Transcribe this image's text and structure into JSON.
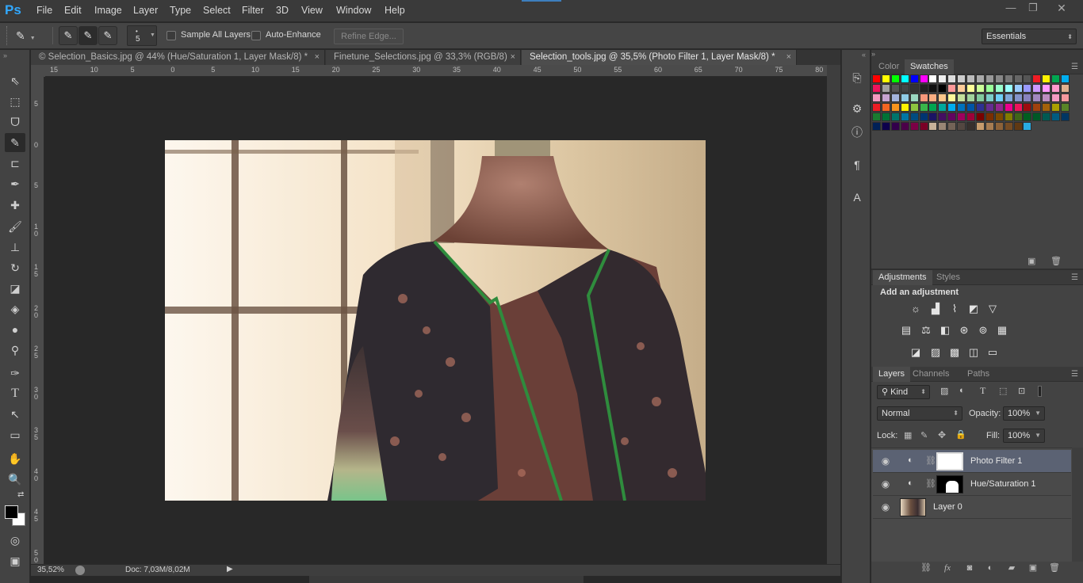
{
  "app": {
    "logo": "Ps"
  },
  "menu": [
    "File",
    "Edit",
    "Image",
    "Layer",
    "Type",
    "Select",
    "Filter",
    "3D",
    "View",
    "Window",
    "Help"
  ],
  "window_controls": {
    "minimize": "—",
    "restore": "❐",
    "close": "✕"
  },
  "options": {
    "brush_size": "5",
    "sample_all_layers": "Sample All Layers",
    "auto_enhance": "Auto-Enhance",
    "refine_edge": "Refine Edge...",
    "workspace": "Essentials"
  },
  "tabs": [
    {
      "label": "© Selection_Basics.jpg @ 44% (Hue/Saturation 1, Layer Mask/8) *",
      "close": "×"
    },
    {
      "label": "Finetune_Selections.jpg @ 33,3% (RGB/8)",
      "close": "×"
    },
    {
      "label": "Selection_tools.jpg @ 35,5% (Photo Filter 1, Layer Mask/8) *",
      "close": "×"
    }
  ],
  "ruler_h": [
    "15",
    "10",
    "5",
    "0",
    "5",
    "10",
    "15",
    "20",
    "25",
    "30",
    "35",
    "40",
    "45",
    "50",
    "55",
    "60",
    "65",
    "70",
    "75",
    "80"
  ],
  "ruler_v": [
    "5",
    "0",
    "5",
    "10",
    "15",
    "20",
    "25",
    "30",
    "35",
    "40",
    "45",
    "50"
  ],
  "status": {
    "zoom": "35,52%",
    "doc": "Doc: 7,03M/8,02M"
  },
  "color_panel": {
    "tabs": [
      "Color",
      "Swatches"
    ]
  },
  "adjustments": {
    "tabs": [
      "Adjustments",
      "Styles"
    ],
    "title": "Add an adjustment"
  },
  "layers_panel": {
    "tabs": [
      "Layers",
      "Channels",
      "Paths"
    ],
    "filter_kind": "Kind",
    "blend_mode": "Normal",
    "opacity_label": "Opacity:",
    "opacity": "100%",
    "lock_label": "Lock:",
    "fill_label": "Fill:",
    "fill": "100%",
    "layers": [
      {
        "name": "Photo Filter 1",
        "selected": true
      },
      {
        "name": "Hue/Saturation 1",
        "selected": false
      },
      {
        "name": "Layer 0",
        "selected": false
      }
    ],
    "footer": [
      "link-icon",
      "fx-icon",
      "mask-icon",
      "adjustment-icon",
      "folder-icon",
      "new-layer-icon",
      "trash-icon"
    ]
  },
  "swatch_colors": [
    "#ff0000",
    "#ffff00",
    "#00ff00",
    "#00ffff",
    "#0000ff",
    "#ff00ff",
    "#ffffff",
    "#eeeeee",
    "#dddddd",
    "#cccccc",
    "#bbbbbb",
    "#aaaaaa",
    "#999999",
    "#888888",
    "#777777",
    "#666666",
    "#555555",
    "#ee1c24",
    "#fff200",
    "#00a651",
    "#00aeef",
    "#ed145b",
    "#a0a0a0",
    "#555555",
    "#444444",
    "#333333",
    "#222222",
    "#111111",
    "#000000",
    "#ff9999",
    "#ffcc99",
    "#ffff99",
    "#ccff99",
    "#99ff99",
    "#99ffcc",
    "#99ffff",
    "#99ccff",
    "#9999ff",
    "#cc99ff",
    "#ff99ff",
    "#ff99cc",
    "#e0b090",
    "#f49ac1",
    "#c5a3d0",
    "#a3b4dd",
    "#8fcbe5",
    "#9ad7c1",
    "#f7977a",
    "#f9ad81",
    "#fdc68a",
    "#fff79a",
    "#c4df9b",
    "#a2d39c",
    "#82ca9d",
    "#7bcdc8",
    "#6ecff6",
    "#7ea7d8",
    "#8493ca",
    "#8882be",
    "#a187be",
    "#bc8dbf",
    "#f49ac2",
    "#f6989d",
    "#ed1c24",
    "#f26522",
    "#f7941d",
    "#fff200",
    "#8dc63f",
    "#39b54a",
    "#00a651",
    "#00a99d",
    "#00aeef",
    "#0072bc",
    "#0054a6",
    "#2e3192",
    "#662d91",
    "#92278f",
    "#ec008c",
    "#ed145b",
    "#9e0b0f",
    "#a0410d",
    "#a3620a",
    "#aba000",
    "#598527",
    "#1a7b30",
    "#007236",
    "#00746b",
    "#0076a3",
    "#004b80",
    "#003471",
    "#1b1464",
    "#440e62",
    "#630460",
    "#9e005d",
    "#9e0039",
    "#790000",
    "#7b2e00",
    "#7d4900",
    "#827b00",
    "#406618",
    "#005e20",
    "#005826",
    "#005952",
    "#005b7f",
    "#003663",
    "#002157",
    "#0d004c",
    "#32004b",
    "#4b0049",
    "#7b0046",
    "#7a0026",
    "#c7b299",
    "#998675",
    "#736357",
    "#534741",
    "#37302d",
    "#c69c6d",
    "#a67c52",
    "#8c6239",
    "#754c24",
    "#603913",
    "#29abe2"
  ]
}
